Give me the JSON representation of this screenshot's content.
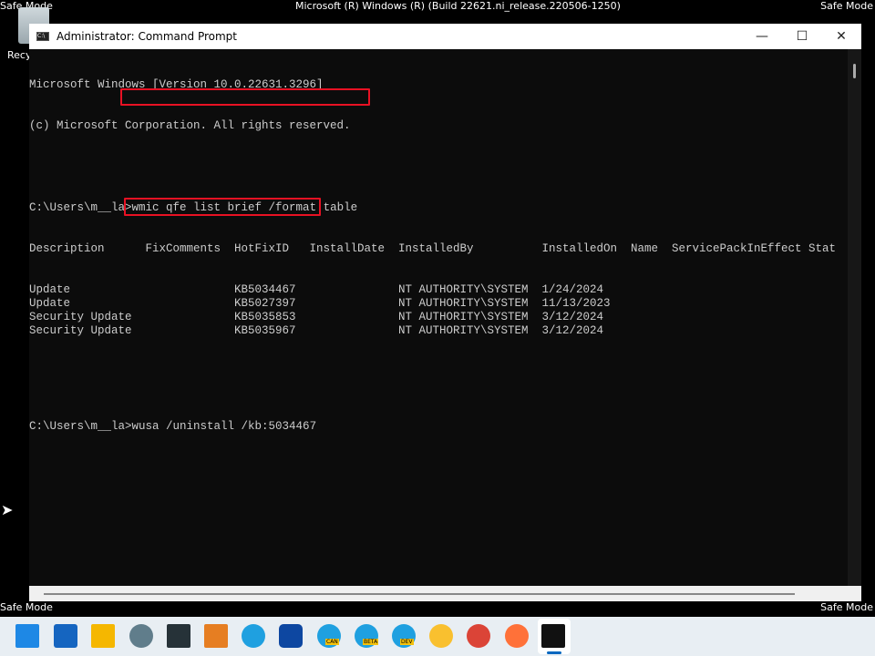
{
  "desktop": {
    "safe_mode": "Safe Mode",
    "os_banner": "Microsoft (R) Windows (R) (Build 22621.ni_release.220506-1250)",
    "recycle_label": "Recy"
  },
  "window": {
    "title": "Administrator: Command Prompt",
    "minimize": "—",
    "maximize": "☐",
    "close": "✕"
  },
  "console": {
    "lines": [
      "Microsoft Windows [Version 10.0.22631.3296]",
      "(c) Microsoft Corporation. All rights reserved."
    ],
    "prompt": "C:\\Users\\m__la>",
    "command1": "wmic qfe list brief /format:table",
    "command2": "wusa /uninstall /kb:5034467",
    "table": {
      "headers": [
        "Description",
        "FixComments",
        "HotFixID",
        "InstallDate",
        "InstalledBy",
        "InstalledOn",
        "Name",
        "ServicePackInEffect",
        "Stat"
      ],
      "rows": [
        [
          "Update",
          "",
          "KB5034467",
          "",
          "NT AUTHORITY\\SYSTEM",
          "1/24/2024",
          "",
          "",
          ""
        ],
        [
          "Update",
          "",
          "KB5027397",
          "",
          "NT AUTHORITY\\SYSTEM",
          "11/13/2023",
          "",
          "",
          ""
        ],
        [
          "Security Update",
          "",
          "KB5035853",
          "",
          "NT AUTHORITY\\SYSTEM",
          "3/12/2024",
          "",
          "",
          ""
        ],
        [
          "Security Update",
          "",
          "KB5035967",
          "",
          "NT AUTHORITY\\SYSTEM",
          "3/12/2024",
          "",
          "",
          ""
        ]
      ]
    },
    "highlight_color": "#e81123"
  },
  "taskbar": {
    "icons": [
      "start-icon",
      "widgets-icon",
      "file-explorer-icon",
      "settings-icon",
      "terminal-icon",
      "tools-icon",
      "edge-icon",
      "store-icon",
      "edge-canary-icon",
      "edge-beta-icon",
      "edge-dev-icon",
      "chrome-canary-icon",
      "chrome-icon",
      "firefox-icon",
      "command-prompt-icon"
    ],
    "badges": {
      "canary": "CAN",
      "beta": "BETA",
      "dev": "DEV"
    }
  }
}
